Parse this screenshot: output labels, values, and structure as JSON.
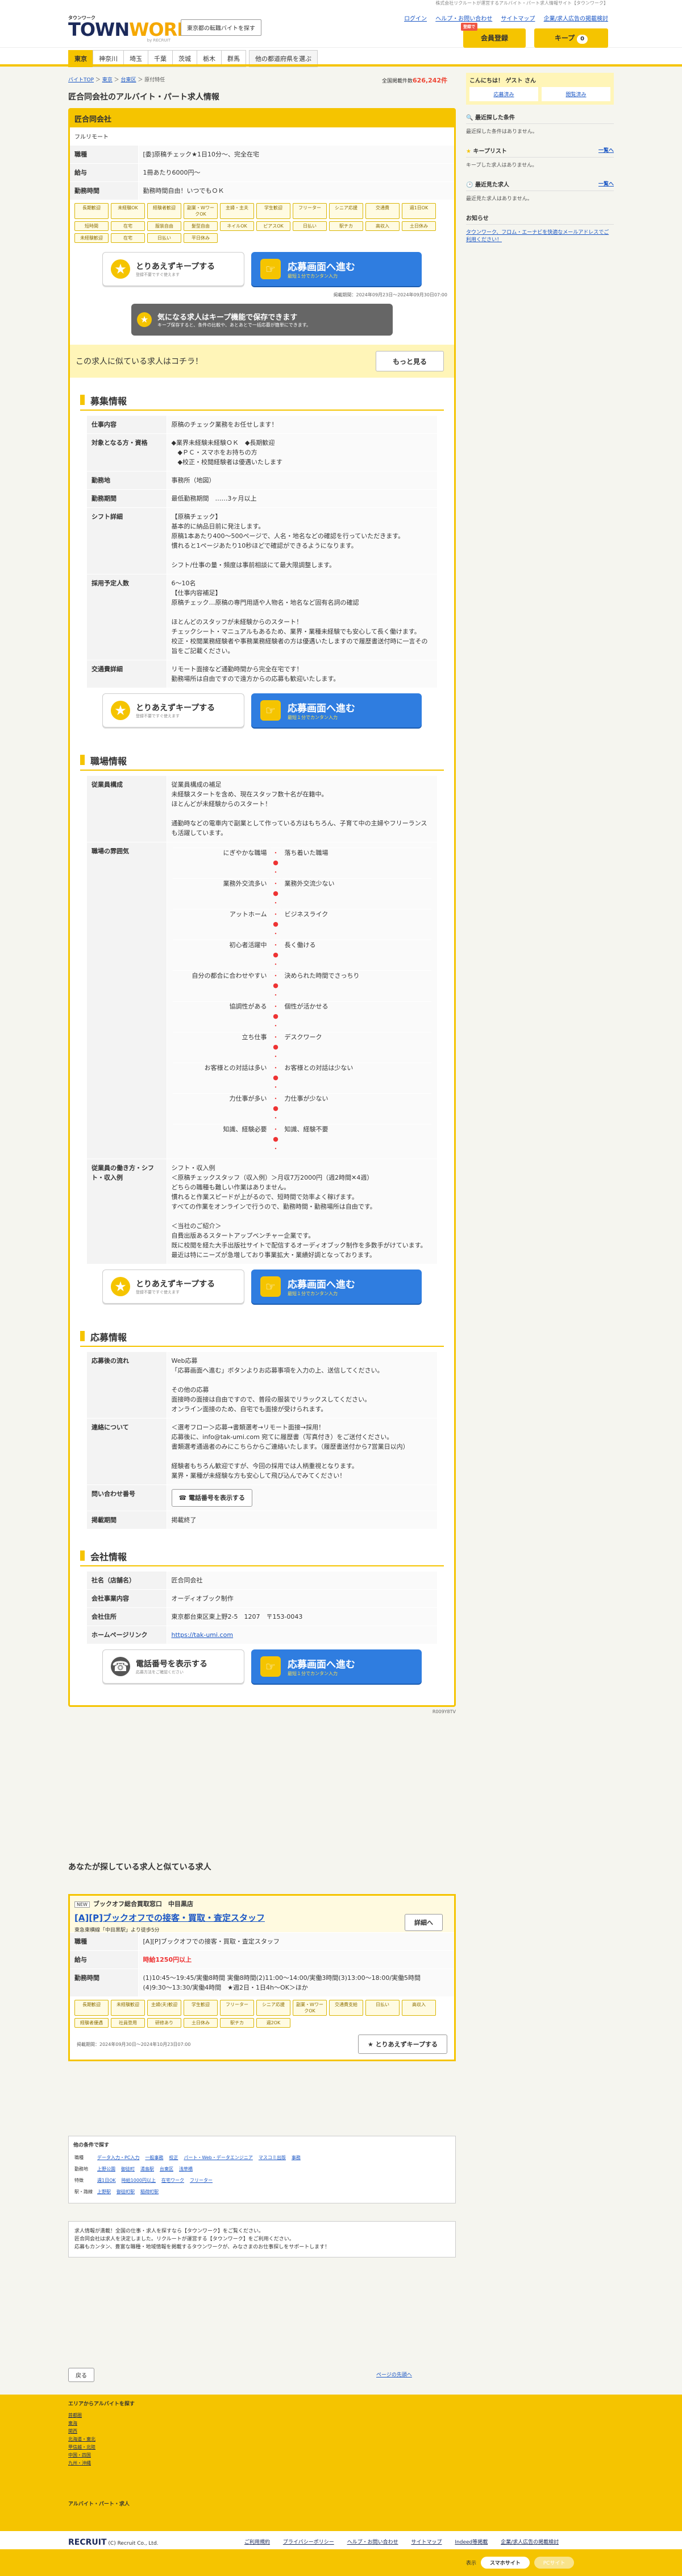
{
  "top_note": "株式会社リクルートが運営するアルバイト・パート求人情報サイト【タウンワーク】",
  "header": {
    "logo_small": "タウンワーク",
    "logo_big": "TOWNWORK",
    "logo_by": "by RECRUIT",
    "region_button": "東京都の転職バイトを探す",
    "links": [
      "ログイン",
      "ヘルプ・お問い合わせ",
      "サイトマップ",
      "企業/求人広告の掲載検討"
    ],
    "member_badge": "登録で",
    "member_label": "会員登録",
    "keep_label": "キープ",
    "keep_count": "0"
  },
  "nav": {
    "tabs": [
      "東京",
      "神奈川",
      "埼玉",
      "千葉",
      "茨城",
      "栃木",
      "群馬"
    ],
    "other": "他の都道府県を選ぶ"
  },
  "breadcrumb": [
    "バイトTOP",
    "東京",
    "台東区",
    "原付特任"
  ],
  "total": {
    "label": "全国掲載件数",
    "count": "626,242件"
  },
  "page_title": "匠合同会社のアルバイト・パート求人情報",
  "job": {
    "company": "匠合同会社",
    "employment": "フルリモート",
    "rows": [
      {
        "k": "職種",
        "v": "[委]原稿チェック★1日10分〜、完全在宅"
      },
      {
        "k": "給与",
        "v": "1冊あたり6000円〜"
      },
      {
        "k": "勤務時間",
        "v": "勤務時間自由！いつでもＯＫ"
      }
    ],
    "tags": [
      "長期歓迎",
      "未経験OK",
      "経験者歓迎",
      "副業・WワークOK",
      "主婦・主夫",
      "学生歓迎",
      "フリーター",
      "シニア応援",
      "交通費",
      "週1日OK",
      "短時間",
      "在宅",
      "服装自由",
      "髪型自由",
      "ネイルOK",
      "ピアスOK",
      "日払い",
      "駅チカ",
      "高収入",
      "土日休み",
      "未経験歓迎",
      "在宅",
      "日払い",
      "平日休み"
    ],
    "published": "掲載期間：2024年09月23日〜2024年09月30日07:00"
  },
  "cta": {
    "keep_t1": "とりあえずキープする",
    "keep_t2": "登録不要ですぐ使えます",
    "apply_t1": "応募画面へ進む",
    "apply_t2": "最短１分でカンタン入力"
  },
  "banner": {
    "t1": "気になる求人はキープ機能で保存できます",
    "t2": "キープ保存すると、条件の比較や、あとあとで一括応募が簡単にできます。"
  },
  "similar": {
    "text": "この求人に似ている求人はコチラ！",
    "more": "もっと見る"
  },
  "recruit": {
    "title": "募集情報",
    "rows": [
      {
        "k": "仕事内容",
        "v": "原稿のチェック業務をお任せします！"
      },
      {
        "k": "対象となる方・資格",
        "v": "◆業界未経験未経験ＯＫ　◆長期歓迎\n　◆ＰＣ・スマホをお持ちの方\n　◆校正・校閲経験者は優遇いたします"
      },
      {
        "k": "勤務地",
        "v": "事務所（地図）"
      },
      {
        "k": "勤務期間",
        "v": "最低勤務期間　……3ヶ月以上"
      },
      {
        "k": "シフト詳細",
        "v": "【原稿チェック】\n基本的に納品日前に発注します。\n原稿1本あたり400〜500ページで、人名・地名などの確認を行っていただきます。\n慣れると1ページあたり10秒ほどで確認ができるようになります。\n\nシフト/仕事の量・頻度は事前相談にて最大限調整します。"
      },
      {
        "k": "採用予定人数",
        "v": "6〜10名\n【仕事内容補足】\n原稿チェック…原稿の専門用語や人物名・地名など固有名詞の確認\n\nほとんどのスタッフが未経験からのスタート！\nチェックシート・マニュアルもあるため、業界・業種未経験でも安心して長く働けます。\n校正・校閲業務経験者や事務業務経験者の方は優遇いたしますので履歴書送付時に一言その旨をご記載ください。"
      },
      {
        "k": "交通費詳細",
        "v": "リモート面接など通勤時間から完全在宅です！\n勤務場所は自由ですので遠方からの応募も歓迎いたします。"
      }
    ]
  },
  "workplace": {
    "title": "職場情報",
    "composition_k": "従業員構成",
    "composition_v": "従業員構成の補足\n未経験スタートを含め、現在スタッフ数十名が在籍中。\nほとんどが未経験からのスタート！\n\n通勤時などの電車内で副業として作っている方はもちろん、子育て中の主婦やフリーランスも活躍しています。",
    "atmos_k": "職場の雰囲気",
    "atmos": [
      [
        "にぎやかな職場",
        "落ち着いた職場"
      ],
      [
        "業務外交流多い",
        "業務外交流少ない"
      ],
      [
        "アットホーム",
        "ビジネスライク"
      ],
      [
        "初心者活躍中",
        "長く働ける"
      ],
      [
        "自分の都合に合わせやすい",
        "決められた時間でさっちり"
      ],
      [
        "協調性がある",
        "個性が活かせる"
      ],
      [
        "立ち仕事",
        "デスクワーク"
      ],
      [
        "お客様との対話は多い",
        "お客様との対話は少ない"
      ],
      [
        "力仕事が多い",
        "力仕事が少ない"
      ],
      [
        "知識、経験必要",
        "知識、経験不要"
      ]
    ],
    "shift_k": "従業員の働き方・シフト・収入例",
    "shift_v": "シフト・収入例\n＜原稿チェックスタッフ（収入例）＞月収7万2000円（週2時間✕4週）\nどちらの職種も難しい作業はありません。\n慣れると作業スピードが上がるので、短時間で効率よく稼げます。\nすべての作業をオンラインで行うので、勤務時間・勤務場所は自由です。\n\n＜当社のご紹介＞\n自費出版あるスタートアップベンチャー企業です。\n既に校閲を経た大手出版社サイトで配信するオーディオブック制作を多数手がけています。\n最近は特にニーズが急増しており事業拡大・業績好調となっております。"
  },
  "apply": {
    "title": "応募情報",
    "rows": [
      {
        "k": "応募後の流れ",
        "v": "Web応募\n「応募画面へ進む」ボタンよりお応募事項を入力の上、送信してください。\n\nその他の応募\n面接時の面接は自由ですので、普段の服装でリラックスしてください。\nオンライン面接のため、自宅でも面接が受けられます。"
      },
      {
        "k": "連絡について",
        "v": "＜選考フロー＞応募→書類選考→リモート面接→採用！\n応募後に、info@tak-umi.com 宛てに履歴書（写真付き）をご送付ください。\n書類選考通過者のみにこちらからご連絡いたします。（履歴書送付から7営業日以内）\n\n経験者もちろん歓迎ですが、今回の採用では人柄重視となります。\n業界・業種が未経験な方も安心して飛び込んでみてください！"
      },
      {
        "k": "問い合わせ番号",
        "v": ""
      },
      {
        "k": "掲載期間",
        "v": "掲載終了"
      }
    ],
    "phone_btn": "電話番号を表示する"
  },
  "company": {
    "title": "会社情報",
    "rows": [
      {
        "k": "社名（店舗名）",
        "v": "匠合同会社"
      },
      {
        "k": "会社事業内容",
        "v": "オーディオブック制作"
      },
      {
        "k": "会社住所",
        "v": "東京都台東区東上野2-5　1207　〒153-0043"
      },
      {
        "k": "ホームページリンク",
        "v": "https://tak-umi.com"
      }
    ],
    "phone_t1": "電話番号を表示する",
    "phone_t2": "応募方法をご確認ください"
  },
  "job_id": "R009Y8TV",
  "related": {
    "heading": "あなたが探している求人と似ている求人",
    "new": "NEW",
    "company": "ブックオフ総合買取窓口　中目黒店",
    "title": "[A][P]ブックオフでの接客・買取・査定スタッフ",
    "sub": "東急東横線「中目黒駅」より徒歩5分",
    "detail": "詳細へ",
    "rows": [
      {
        "k": "職種",
        "v": "[A][P]ブックオフでの接客・買取・査定スタッフ"
      },
      {
        "k": "給与",
        "v": "時給1250円以上"
      },
      {
        "k": "勤務時間",
        "v": "(1)10:45〜19:45/実働8時間 実働8時間(2)11:00〜14:00/実働3時間(3)13:00〜18:00/実働5時間(4)9:30〜13:30/実働4時間　★週2日・1日4h〜OK＞ほか"
      }
    ],
    "tags": [
      "長期歓迎",
      "未経験歓迎",
      "主婦(夫)歓迎",
      "学生歓迎",
      "フリーター",
      "シニア応援",
      "副業・WワークOK",
      "交通費支給",
      "日払い",
      "高収入",
      "経験者優遇",
      "社員登用",
      "研修あり",
      "土日休み",
      "駅チカ",
      "週2OK"
    ],
    "published": "掲載期間：2024年09月30日〜2024年10月23日07:00",
    "keep": "とりあえずキープする"
  },
  "conditions": {
    "heading": "他の条件で探す",
    "rows": [
      {
        "k": "職種",
        "items": [
          "データ入力・PC入力",
          "一般事務",
          "校正",
          "パート・Web・データエンジニア",
          "マスコミ出版",
          "事務"
        ]
      },
      {
        "k": "勤務地",
        "items": [
          "上野公園",
          "御徒町",
          "湯島駅",
          "台東区",
          "浅草橋"
        ]
      },
      {
        "k": "特徴",
        "items": [
          "週1日OK",
          "時給1000円以上",
          "在宅ワーク",
          "フリーター"
        ]
      },
      {
        "k": "駅・路線",
        "items": [
          "上野駅",
          "御徒町駅",
          "稲荷町駅"
        ]
      }
    ]
  },
  "info_text": "求人情報が満載！全国の仕事・求人を探すなら【タウンワーク】をご覧ください。\n匠合同会社は求人を決定しました。リクルートが運営する【タウンワーク】をご利用ください。\n応募もカンタン、豊富な職種・地域情報を掲載するタウンワークが、みなさまのお仕事探しをサポートします！",
  "back": "戻る",
  "pagetop": "ページの先頭へ",
  "footer": {
    "search_area": "エリアからアルバイトを探す",
    "areas": [
      "首都圏",
      "東海",
      "関西",
      "北海道・東北",
      "甲信越・北陸",
      "中国・四国",
      "九州・沖縄"
    ],
    "recruit_head": "アルバイト・パート・求人",
    "links": [
      "ご利用規約",
      "プライバシーポリシー",
      "ヘルプ・お問い合わせ",
      "サイトマップ",
      "Indeed等掲載",
      "企業/求人広告の掲載検討"
    ],
    "copyright": "(C) Recruit Co., Ltd.",
    "display_label": "表示",
    "sp": "スマホサイト",
    "pc": "PCサイト"
  },
  "sidebar": {
    "cond_title": "こんにちは！ ゲスト さん",
    "cond_links": [
      "応募済み",
      "閲覧済み"
    ],
    "recent_title": "最近探した条件",
    "recent_body": "最近探した条件はありません。",
    "keep_title": "キープリスト",
    "keep_more": "一覧へ",
    "keep_body": "キープした求人はありません。",
    "viewed_title": "最近見た求人",
    "viewed_more": "一覧へ",
    "viewed_body": "最近見た求人はありません。",
    "news_title": "お知らせ",
    "news_body": "タウンワーク、フロム・エーナビを快適なメールアドレスでご利用ください！"
  },
  "colors": {
    "brand_yellow": "#f5c400",
    "navy": "#1c2a5a",
    "apply_blue": "#2f7de0"
  }
}
